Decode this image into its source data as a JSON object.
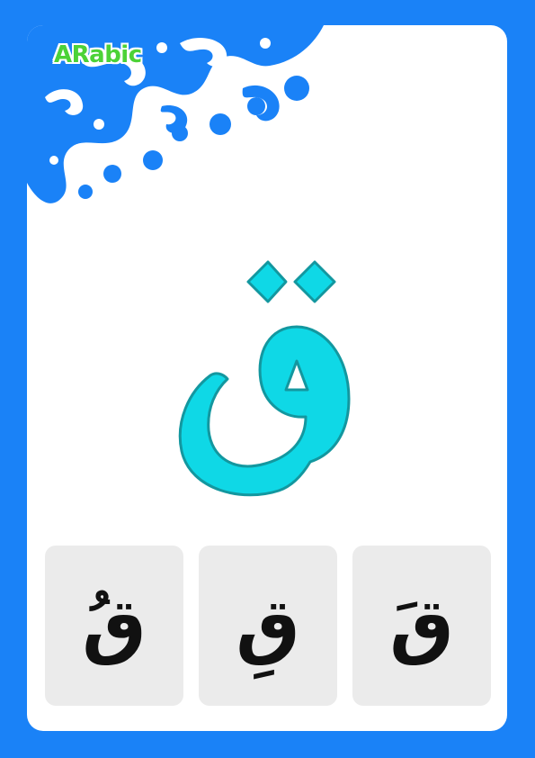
{
  "brand": {
    "label": "ARabic"
  },
  "main_letter": {
    "char": "ق",
    "fill": "#0fd8e6",
    "stroke": "#13979f"
  },
  "tiles": [
    {
      "char": "قُ"
    },
    {
      "char": "قِ"
    },
    {
      "char": "قَ"
    }
  ],
  "colors": {
    "frame": "#1a82f7",
    "tile_bg": "#ebebeb",
    "brand": "#4cd237"
  }
}
